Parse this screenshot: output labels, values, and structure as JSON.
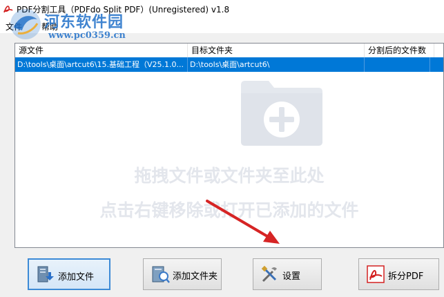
{
  "window": {
    "title": "PDF分割工具（PDFdo Split PDF）(Unregistered) v1.8"
  },
  "watermark": {
    "site_name": "河东软件园",
    "url": "www.pc0359.cn"
  },
  "menu": {
    "items": [
      {
        "label": "文件"
      },
      {
        "label": "帮助"
      }
    ]
  },
  "file_list": {
    "columns": [
      "源文件",
      "目标文件夹",
      "分割后的文件数"
    ],
    "rows": [
      {
        "source": "D:\\tools\\桌面\\artcut6\\15.基础工程（V25.1.0...",
        "target": "D:\\tools\\桌面\\artcut6\\",
        "count": ""
      }
    ],
    "hint_line1": "拖拽文件或文件夹至此处",
    "hint_line2": "点击右键移除或打开已添加的文件"
  },
  "buttons": {
    "add_file": "添加文件",
    "add_folder": "添加文件夹",
    "settings": "设置",
    "split_pdf": "拆分PDF"
  },
  "colors": {
    "selection": "#0078d7",
    "primary_border": "#3c8ad6",
    "annotation_arrow": "#d62424"
  }
}
